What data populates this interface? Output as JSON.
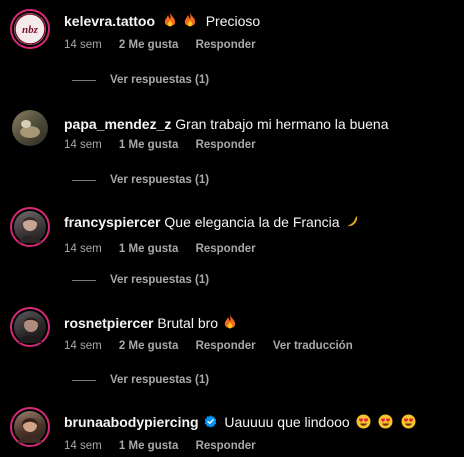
{
  "colors": {
    "background": "#000000",
    "text": "#f5f5f5",
    "muted": "#a8a8a8",
    "story_ring": "#d62976",
    "verified": "#0095f6"
  },
  "comments": [
    {
      "username": "kelevra.tattoo",
      "text": "Precioso",
      "emojis_before": [
        "fire-emoji",
        "fire-emoji"
      ],
      "time": "14 sem",
      "likes": "2 Me gusta",
      "reply": "Responder",
      "view_replies": "Ver respuestas (1)",
      "avatar_logo": "nbz"
    },
    {
      "username": "papa_mendez_z",
      "text": "Gran trabajo mi hermano la buena",
      "time": "14 sem",
      "likes": "1 Me gusta",
      "reply": "Responder",
      "view_replies": "Ver respuestas (1)"
    },
    {
      "username": "francyspiercer",
      "text": "Que elegancia la de Francia",
      "emojis_after": [
        "crescent-moon-emoji"
      ],
      "time": "14 sem",
      "likes": "1 Me gusta",
      "reply": "Responder",
      "view_replies": "Ver respuestas (1)"
    },
    {
      "username": "rosnetpiercer",
      "text": "Brutal bro",
      "emojis_after": [
        "fire-emoji"
      ],
      "time": "14 sem",
      "likes": "2 Me gusta",
      "reply": "Responder",
      "translate": "Ver traducción",
      "view_replies": "Ver respuestas (1)"
    },
    {
      "username": "brunaabodypiercing",
      "verified": true,
      "text": "Uauuuu que lindooo",
      "emojis_after": [
        "heart-eyes-emoji",
        "heart-eyes-emoji",
        "heart-eyes-emoji"
      ],
      "time": "14 sem",
      "likes": "1 Me gusta",
      "reply": "Responder"
    }
  ]
}
